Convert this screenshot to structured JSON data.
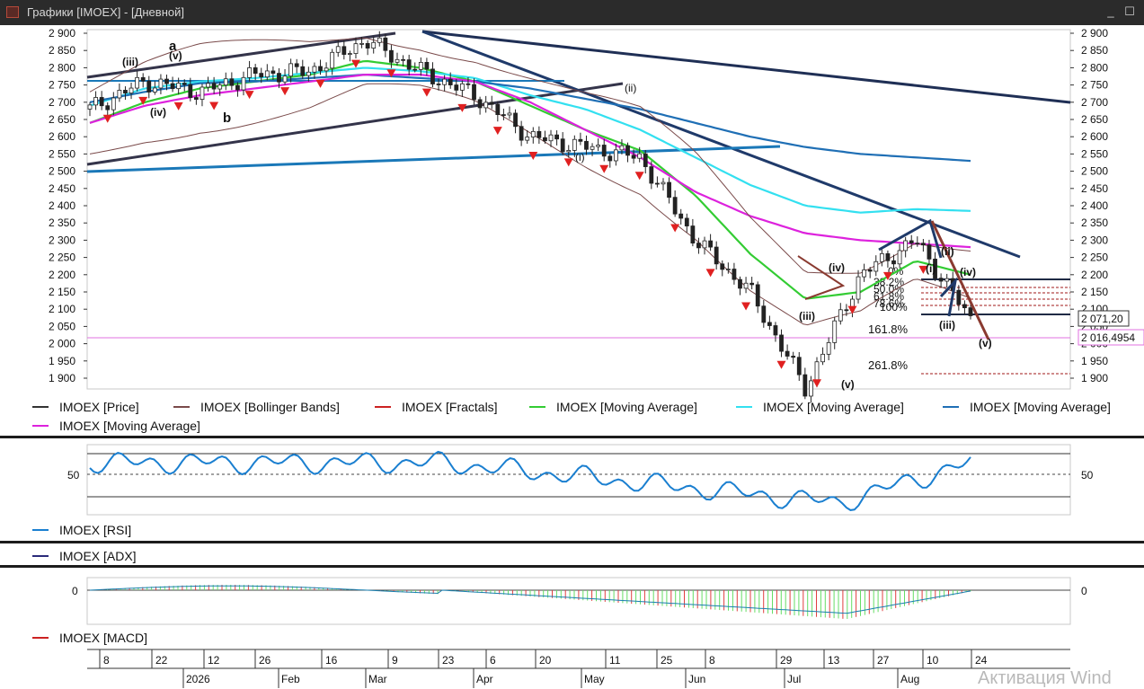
{
  "window": {
    "title": "Графики [IMOEX] - [Дневной]",
    "minimize": "_",
    "maximize": "☐",
    "close": "✕"
  },
  "price_axis": {
    "ticks": [
      "2 900",
      "2 850",
      "2 800",
      "2 750",
      "2 700",
      "2 650",
      "2 600",
      "2 550",
      "2 500",
      "2 450",
      "2 400",
      "2 350",
      "2 300",
      "2 250",
      "2 200",
      "2 150",
      "2 100",
      "2 050",
      "2 000",
      "1 950",
      "1 900"
    ],
    "last_price": "2 071,20",
    "level": "2 016,4954"
  },
  "fib_labels": {
    "f0": "0%",
    "f382": "38.2%",
    "f50": "50.0%",
    "f618": "61.8%",
    "f786": "78.6%",
    "f100": "100%",
    "f1618": "161.8%",
    "f2618": "261.8%"
  },
  "wave_labels": {
    "a": "a",
    "b": "b",
    "iii_top": "(iii)",
    "v_top": "(v)",
    "iv_top": "(iv)",
    "ii": "(ii)",
    "i": "(i)",
    "iv": "(iv)",
    "iii": "(iii)",
    "v_low": "(v)",
    "i2": "(i)",
    "ii2": "(ii)",
    "iii2": "(iii)",
    "iv2": "(iv)",
    "v_proj": "(v)"
  },
  "legend": [
    {
      "label": "IMOEX [Price]",
      "color": "#333333"
    },
    {
      "label": "IMOEX [Bollinger Bands]",
      "color": "#7a4a4a"
    },
    {
      "label": "IMOEX [Fractals]",
      "color": "#cc2222"
    },
    {
      "label": "IMOEX [Moving Average]",
      "color": "#33cc33"
    },
    {
      "label": "IMOEX [Moving Average]",
      "color": "#33e0f0"
    },
    {
      "label": "IMOEX [Moving Average]",
      "color": "#1f6fb5"
    },
    {
      "label": "IMOEX [Moving Average]",
      "color": "#dd22dd"
    }
  ],
  "rsi": {
    "legend": "IMOEX [RSI]",
    "level": "50",
    "color": "#1a7fd0"
  },
  "adx": {
    "legend": "IMOEX [ADX]",
    "color": "#2a2a7a"
  },
  "macd": {
    "legend": "IMOEX [MACD]",
    "zero": "0",
    "color": "#cc2222"
  },
  "time_axis": {
    "days": [
      "8",
      "22",
      "12",
      "26",
      "16",
      "9",
      "23",
      "6",
      "20",
      "11",
      "25",
      "8",
      "29",
      "13",
      "27",
      "10",
      "24"
    ],
    "months": [
      "2026",
      "Feb",
      "Mar",
      "Apr",
      "May",
      "Jun",
      "Jul",
      "Aug"
    ]
  },
  "watermark": "Активация Wind",
  "chart_data": {
    "type": "line",
    "title": "IMOEX",
    "x": [
      "2026-01-01",
      "2026-01-16",
      "2026-02-01",
      "2026-02-16",
      "2026-03-01",
      "2026-03-16",
      "2026-04-01",
      "2026-04-16",
      "2026-05-01",
      "2026-05-16",
      "2026-06-01",
      "2026-06-16",
      "2026-07-01",
      "2026-07-16",
      "2026-08-01",
      "2026-08-10",
      "2026-08-20"
    ],
    "series": [
      {
        "name": "IMOEX [Price]",
        "values": [
          2680,
          2760,
          2730,
          2780,
          2790,
          2880,
          2790,
          2720,
          2600,
          2570,
          2540,
          2300,
          2150,
          1870,
          2200,
          2300,
          2071
        ]
      },
      {
        "name": "IMOEX [Moving Average]",
        "values": [
          2640,
          2700,
          2740,
          2760,
          2780,
          2820,
          2800,
          2760,
          2690,
          2620,
          2560,
          2430,
          2260,
          2130,
          2150,
          2240,
          2200
        ]
      },
      {
        "name": "IMOEX [Moving Average]",
        "values": [
          2690,
          2740,
          2760,
          2770,
          2785,
          2800,
          2790,
          2770,
          2720,
          2680,
          2620,
          2540,
          2460,
          2400,
          2380,
          2390,
          2385
        ]
      },
      {
        "name": "IMOEX [Moving Average]",
        "values": [
          2700,
          2730,
          2755,
          2760,
          2770,
          2780,
          2770,
          2760,
          2740,
          2710,
          2680,
          2640,
          2600,
          2570,
          2550,
          2540,
          2530
        ]
      },
      {
        "name": "IMOEX [Moving Average]",
        "values": [
          2640,
          2690,
          2720,
          2740,
          2760,
          2780,
          2780,
          2760,
          2700,
          2620,
          2540,
          2440,
          2370,
          2320,
          2300,
          2290,
          2280
        ]
      }
    ],
    "ylim": [
      1880,
      2920
    ],
    "rsi_level": 50,
    "macd_zero": 0
  }
}
